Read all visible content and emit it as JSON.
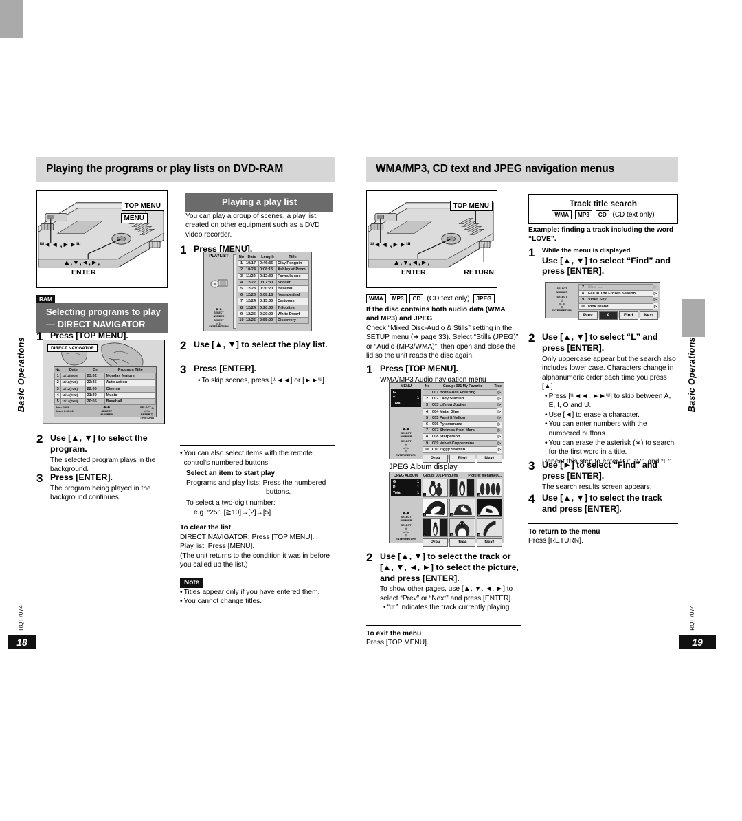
{
  "left_page": {
    "number": "18",
    "code": "RQT7074",
    "side_tab": "Basic Operations",
    "banner": "Playing the programs or play lists on DVD-RAM",
    "device": {
      "labels": [
        "TOP MENU",
        "MENU"
      ],
      "skip_label": "ᵚ◄◄ ,►►ᵚ",
      "cursor_label": "▲,▼,◄,►,",
      "enter_label": "ENTER"
    },
    "media_badge": "RAM",
    "sub_banner_line1": "Selecting programs to play",
    "sub_banner_line2": "— DIRECT NAVIGATOR",
    "steps": [
      {
        "num": "1",
        "head": "Press [TOP MENU]."
      },
      {
        "num": "2",
        "head": "Use [▲, ▼] to select the program.",
        "sub": "The selected program plays in the background."
      },
      {
        "num": "3",
        "head": "Press [ENTER].",
        "sub": "The program being played in the background continues."
      }
    ],
    "direct_navigator": {
      "title": "DIRECT NAVIGATOR",
      "columns": [
        "No",
        "Date",
        "On",
        "Program Title"
      ],
      "rows": [
        [
          "1",
          "11/11(MON)",
          "23:02",
          "Monday feature"
        ],
        [
          "2",
          "11/12(TUE)",
          "22:35",
          "Auto action"
        ],
        [
          "3",
          "11/12(TUE)",
          "22:00",
          "Cinema"
        ],
        [
          "4",
          "11/14(THU)",
          "21:30",
          "Music"
        ],
        [
          "5",
          "11/14(THU)",
          "20:05",
          "Baseball"
        ]
      ],
      "footer_left_1": "Nov. 2003",
      "footer_left_2": "Used 0:49:60",
      "footer_mid_1": "❶~❿",
      "footer_mid_2": "SELECT",
      "footer_mid_3": "NUMBER",
      "footer_right_1": "SELECT △",
      "footer_right_2": "◁□▷",
      "footer_right_3": "ENTER ▽",
      "footer_right_4": "○ RETURN"
    },
    "playlist_section": {
      "sub_banner": "Playing a play list",
      "intro": "You can play a group of scenes, a play list, created on other equipment such as a DVD video recorder.",
      "steps": [
        {
          "num": "1",
          "head": "Press [MENU]."
        },
        {
          "num": "2",
          "head": "Use [▲, ▼] to select the play list."
        },
        {
          "num": "3",
          "head": "Press [ENTER].",
          "bullet": "To skip scenes, press [ᵚ◄◄] or [►►ᵚ]."
        }
      ],
      "playlist_screen": {
        "title": "PLAYLIST",
        "columns": [
          "No",
          "Date",
          "Length",
          "Title"
        ],
        "rows": [
          [
            "1",
            "10/17",
            "0:46:35",
            "Clay Penguin"
          ],
          [
            "2",
            "10/24",
            "0:08:15",
            "Ashley at Prom"
          ],
          [
            "3",
            "11/29",
            "0:12:32",
            "Formula one"
          ],
          [
            "4",
            "12/22",
            "0:07:30",
            "Soccer"
          ],
          [
            "5",
            "12/23",
            "0:30:20",
            "Baseball"
          ],
          [
            "6",
            "12/23",
            "0:08:15",
            "Neanderthal"
          ],
          [
            "7",
            "12/24",
            "0:15:30",
            "Cartoons"
          ],
          [
            "8",
            "12/24",
            "0:20:30",
            "Trilobites"
          ],
          [
            "9",
            "12/25",
            "0:20:00",
            "White Dwarf"
          ],
          [
            "10",
            "12/25",
            "0:55:00",
            "Discovery"
          ]
        ]
      }
    },
    "notes": {
      "remote_bullet": "You can also select items with the remote control's numbered buttons.",
      "select_item_head": "Select an item to start play",
      "select_item_l1": "Programs and play lists:  Press the numbered",
      "select_item_l2": "buttons.",
      "two_digit_l1": "To select a two-digit number:",
      "two_digit_l2": "e.g. “25”:  [≧10]→[2]→[5]",
      "clear_head": "To clear the list",
      "clear_l1": "DIRECT NAVIGATOR:  Press [TOP MENU].",
      "clear_l2": "Play list:  Press [MENU].",
      "clear_l3": "(The unit returns to the condition it was in before you called up the list.)",
      "note_tag": "Note",
      "note_b1": "Titles appear only if you have entered them.",
      "note_b2": "You cannot change titles."
    }
  },
  "right_page": {
    "number": "19",
    "code": "RQT7074",
    "side_tab": "Basic Operations",
    "banner": "WMA/MP3, CD text and JPEG navigation menus",
    "device": {
      "labels": [
        "TOP MENU",
        "RETURN"
      ],
      "skip_label": "ᵚ◄◄ ,►►ᵚ",
      "cursor_label": "▲,▼,◄,►,",
      "enter_label": "ENTER"
    },
    "badge_row": {
      "badges": [
        "WMA",
        "MP3",
        "CD"
      ],
      "note": "(CD text only)",
      "badge_last": "JPEG"
    },
    "mixed_disc": {
      "head_l1": "If the disc contains both audio data (WMA",
      "head_l2": "and MP3) and JPEG",
      "body": "Check “Mixed Disc-Audio & Stills” setting in the SETUP menu (➜ page 33). Select “Stills (JPEG)” or “Audio (MP3/WMA)”, then open and close the lid so the unit reads the disc again."
    },
    "steps": [
      {
        "num": "1",
        "head": "Press [TOP MENU].",
        "caption": "WMA/MP3 Audio navigation menu"
      },
      {
        "num": "2",
        "head": "Use [▲, ▼] to select the track or [▲, ▼, ◄, ►] to select the picture, and press [ENTER].",
        "sub": "To show other pages, use [▲, ▼, ◄, ►] to select “Prev” or “Next” and press [ENTER].",
        "bullet": "“☞” indicates the track currently playing."
      }
    ],
    "audio_menu": {
      "title": "MENU",
      "stats": [
        [
          "G",
          "1"
        ],
        [
          "T",
          "1"
        ],
        [
          "Total",
          "1"
        ]
      ],
      "hdr_no": "No",
      "hdr_group": "Group:  001 My Favorite",
      "hdr_tree": "Tree",
      "rows": [
        [
          "1",
          "001 Both Ends Freezing"
        ],
        [
          "2",
          "002 Lady Starfish"
        ],
        [
          "3",
          "003 Life on Jupiter"
        ],
        [
          "4",
          "004 Metal Glue"
        ],
        [
          "5",
          "005 Paint It Yellow"
        ],
        [
          "6",
          "006 Pyjamarama"
        ],
        [
          "7",
          "007 Shrimps from Mars"
        ],
        [
          "8",
          "008 Starperson"
        ],
        [
          "9",
          "009 Velvet Cuppermine"
        ],
        [
          "10",
          "010 Ziggy Starfish"
        ]
      ],
      "buttons": [
        "Prev",
        "Find",
        "Next"
      ],
      "pad_1": "❶~❿",
      "pad_2": "SELECT",
      "pad_3": "NUMBER",
      "pad_4": "SELECT",
      "pad_5": "ENTER   RETURN"
    },
    "jpeg_caption": "JPEG Album display",
    "jpeg_menu": {
      "title": "JPEG ALBUM",
      "stats": [
        [
          "G",
          "1"
        ],
        [
          "P",
          "1"
        ],
        [
          "Total",
          "1"
        ]
      ],
      "hdr_group": "Group:  001 Penguins",
      "hdr_picture": "Picture: filename00..",
      "thumbs": [
        "1",
        "2",
        "3",
        "4",
        "5",
        "6",
        "7",
        "8",
        "9"
      ],
      "buttons": [
        "Prev",
        "Tree",
        "Next"
      ]
    },
    "exit_head": "To exit the menu",
    "exit_body": "Press [TOP MENU]."
  },
  "far_column": {
    "box_title": "Track title search",
    "box_badges": [
      "WMA",
      "MP3",
      "CD"
    ],
    "box_note": "(CD text only)",
    "example_l1": "Example:  finding a track including the word",
    "example_l2": "“LOVE”.",
    "steps": [
      {
        "num": "1",
        "pre": "While the menu is displayed",
        "head": "Use [▲, ▼] to select “Find” and press [ENTER]."
      },
      {
        "num": "2",
        "head": "Use [▲, ▼] to select “L” and press [ENTER].",
        "sub": "Only uppercase appear but the search also includes lower case. Characters change in alphanumeric order each time you press [▲].",
        "bullets": [
          "Press [ᵚ◄◄, ►►ᵚ] to skip between A, E, I, O and U.",
          "Use [◄] to erase a character.",
          "You can enter numbers with the numbered buttons.",
          "You can erase the asterisk (∗) to search for the first word in a title."
        ],
        "tail": "Repeat this step to enter “O”, “V”, and “E”."
      },
      {
        "num": "3",
        "head": "Use [►] to select “Find” and press [ENTER].",
        "sub": "The search results screen appears."
      },
      {
        "num": "4",
        "head": "Use [▲, ▼] to select the track and press [ENTER]."
      }
    ],
    "find_screen": {
      "pad_1": "SELECT",
      "pad_2": "NUMBER",
      "pad_3": "SELECT",
      "pad_4": "ENTER   RETURN",
      "rows": [
        [
          "7",
          "Blue L..."
        ],
        [
          "8",
          "Fall In The Frozen Season"
        ],
        [
          "9",
          "Violet Sky"
        ],
        [
          "10",
          "Pink Island"
        ]
      ],
      "buttons": [
        "Prev",
        "A",
        "Find",
        "Next"
      ]
    },
    "return_head": "To return to the menu",
    "return_body": "Press [RETURN]."
  }
}
